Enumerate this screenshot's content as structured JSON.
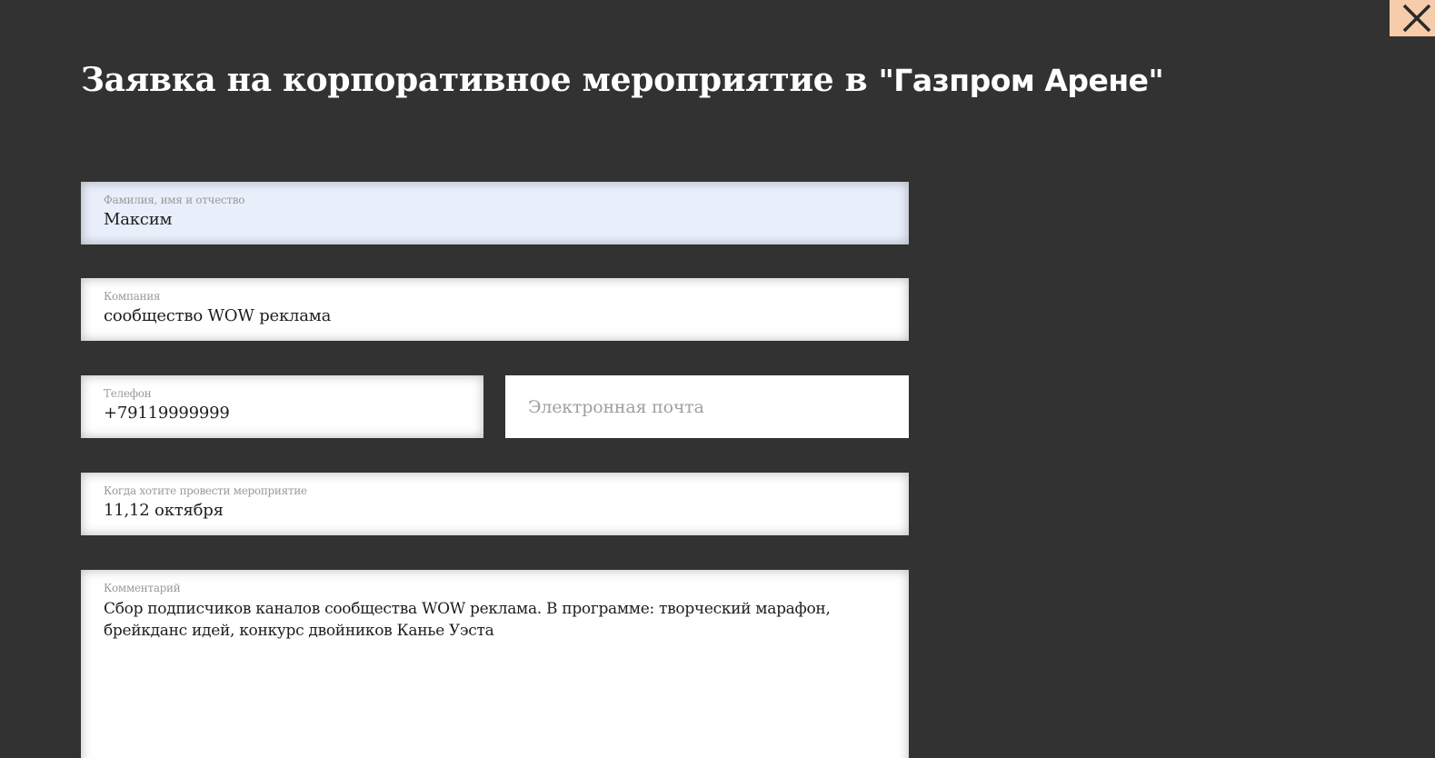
{
  "form": {
    "title_main": "Заявка на корпоративное мероприятие в ",
    "title_brand": "\"Газпром Арене\"",
    "fields": {
      "full_name": {
        "label": "Фамилия, имя и отчество",
        "value": "Максим"
      },
      "company": {
        "label": "Компания",
        "value": "сообщество WOW реклама"
      },
      "phone": {
        "label": "Телефон",
        "value": "+79119999999"
      },
      "email": {
        "placeholder": "Электронная почта",
        "value": ""
      },
      "event_date": {
        "label": "Когда хотите провести мероприятие",
        "value": "11,12 октября"
      },
      "comment": {
        "label": "Комментарий",
        "value": "Сбор подписчиков каналов сообщества WOW реклама. В программе: творческий марафон, брейкданс идей, конкурс двойников Канье Уэста"
      }
    }
  },
  "icons": {
    "close": "close-icon"
  },
  "colors": {
    "background": "#323232",
    "close_button_bg": "#f7ccaa",
    "autofill_bg": "#e8eefa",
    "field_bg": "#ffffff"
  }
}
